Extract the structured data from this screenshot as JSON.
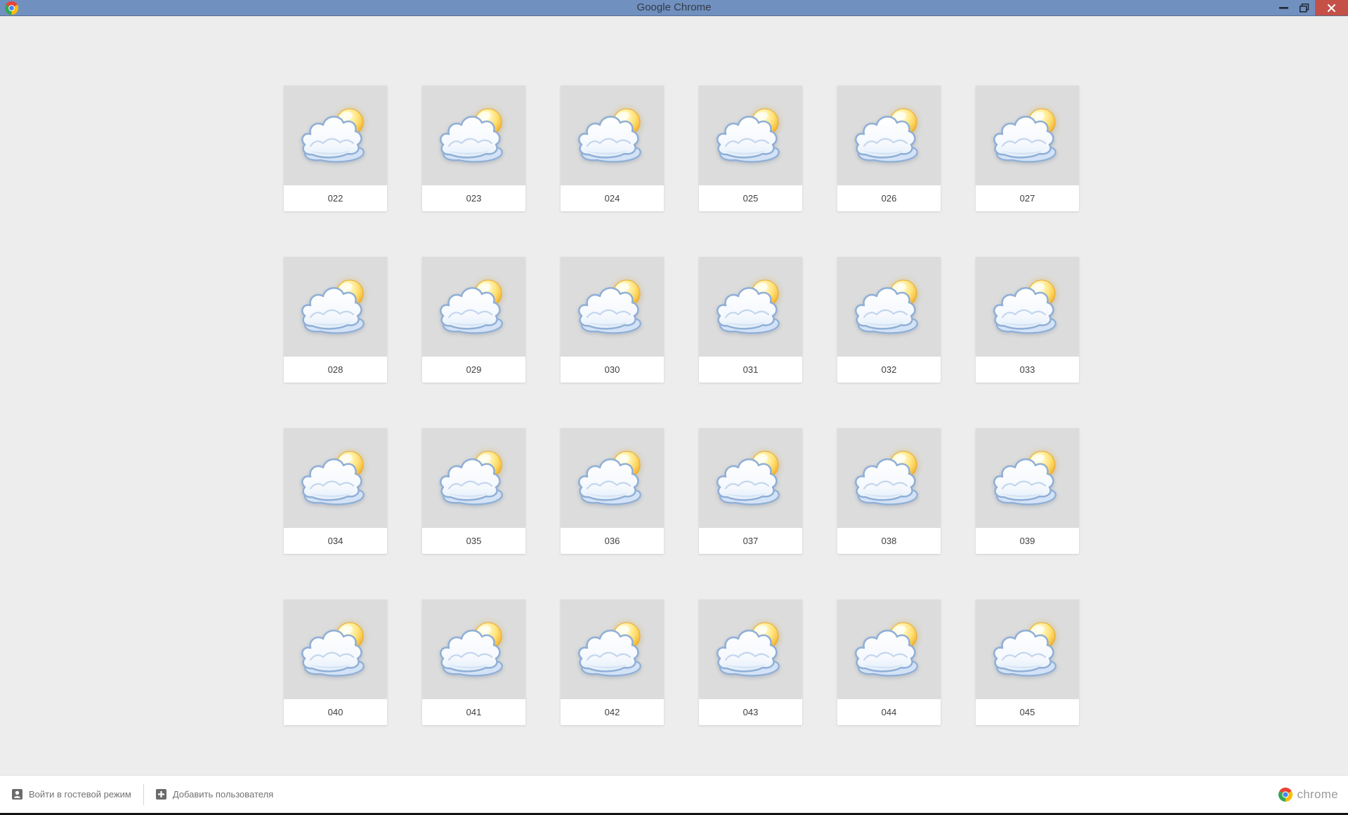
{
  "window": {
    "title": "Google Chrome"
  },
  "colors": {
    "titlebar": "#7090bf",
    "close_button": "#c45048",
    "tile_bg": "#dcdcdc",
    "page_bg": "#ededed",
    "footer_icon": "#6b6b6b",
    "chrome_red": "#ea4335",
    "chrome_green": "#34a853",
    "chrome_yellow": "#fbbc05",
    "chrome_blue": "#4285f4"
  },
  "profiles": {
    "avatar_icon": "partly-cloudy-weather-icon",
    "labels": [
      "022",
      "023",
      "024",
      "025",
      "026",
      "027",
      "028",
      "029",
      "030",
      "031",
      "032",
      "033",
      "034",
      "035",
      "036",
      "037",
      "038",
      "039",
      "040",
      "041",
      "042",
      "043",
      "044",
      "045"
    ]
  },
  "footer": {
    "guest_button_label": "Войти в гостевой режим",
    "add_user_button_label": "Добавить пользователя",
    "brand_label": "chrome"
  }
}
